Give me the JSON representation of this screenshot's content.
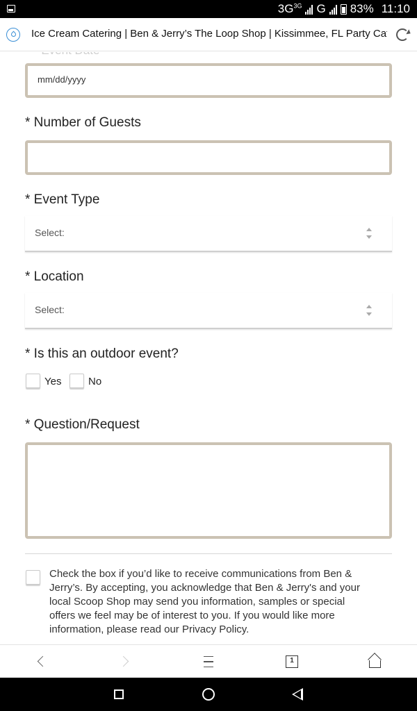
{
  "status_bar": {
    "network": "3G",
    "network_small": "3G",
    "network_g": "G",
    "battery": "83%",
    "time": "11:10"
  },
  "browser": {
    "page_title": "Ice Cream Catering | Ben & Jerry’s The Loop Shop | Kissimmee, FL Party Cate",
    "tab_count": "1"
  },
  "form": {
    "event_date": {
      "label": "* Event Date",
      "placeholder": "mm/dd/yyyy"
    },
    "guests": {
      "label": "* Number of Guests",
      "value": ""
    },
    "event_type": {
      "label": "* Event Type",
      "selected": "Select:"
    },
    "location": {
      "label": "* Location",
      "selected": "Select:"
    },
    "outdoor": {
      "label": "* Is this an outdoor event?",
      "options": [
        {
          "label": "Yes",
          "checked": false
        },
        {
          "label": "No",
          "checked": false
        }
      ]
    },
    "question": {
      "label": "* Question/Request",
      "value": ""
    },
    "consent": {
      "checked": false,
      "text": "Check the box if you’d like to receive communications from Ben & Jerry’s. By accepting, you acknowledge that Ben & Jerry's and your local Scoop Shop may send you information, samples or special offers we feel may be of interest to you. If you would like more information, please read our Privacy Policy."
    }
  },
  "icons": {
    "status_notification": "image-notification-icon",
    "site": "site-info-icon",
    "reload": "reload-icon",
    "back": "back-arrow-icon",
    "forward": "forward-arrow-icon",
    "menu": "menu-icon",
    "tabs": "tabs-icon",
    "home": "home-icon"
  },
  "colors": {
    "input_border": "#cbc2b3",
    "status_bar_bg": "#000000",
    "site_icon": "#3a8fd6"
  }
}
